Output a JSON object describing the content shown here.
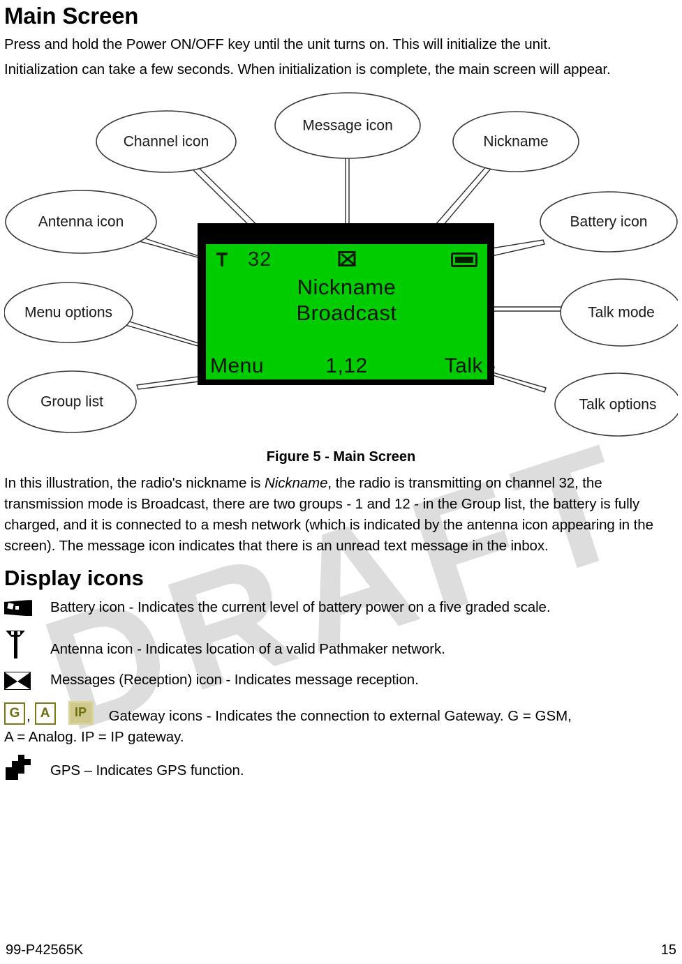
{
  "section1": {
    "heading": "Main Screen",
    "para1": "Press and hold the Power ON/OFF key until the unit turns on. This will initialize the unit.",
    "para2": "Initialization can take a few seconds. When initialization is complete, the main screen will appear."
  },
  "watermark": {
    "text": "DRAFT"
  },
  "figure": {
    "caption": "Figure 5 - Main Screen",
    "callouts": [
      {
        "id": "channel-icon",
        "label": "Channel icon"
      },
      {
        "id": "message-icon",
        "label": "Message icon"
      },
      {
        "id": "nickname",
        "label": "Nickname"
      },
      {
        "id": "antenna-icon",
        "label": "Antenna icon"
      },
      {
        "id": "battery-icon",
        "label": "Battery icon"
      },
      {
        "id": "menu-options",
        "label": "Menu options"
      },
      {
        "id": "talk-mode",
        "label": "Talk mode"
      },
      {
        "id": "group-list",
        "label": "Group list"
      },
      {
        "id": "talk-options",
        "label": "Talk options"
      }
    ],
    "lcd": {
      "channel": "32",
      "nickname": "Nickname",
      "mode": "Broadcast",
      "soft_left": "Menu",
      "group_list": "1,12",
      "soft_right": "Talk",
      "screen_color": "#00cc00",
      "bezel_color": "#000000"
    }
  },
  "description": {
    "text_before_italic": "In this illustration, the radio's nickname is ",
    "italic_word": "Nickname",
    "text_after_italic": ", the radio is transmitting on channel 32, the transmission mode is Broadcast, there are two groups - 1 and 12 - in the Group list, the battery is fully charged, and it is connected to a mesh network (which is indicated by the antenna icon appearing in the screen). The message icon indicates that there is an unread text message in the inbox."
  },
  "section2": {
    "heading": "Display icons",
    "items": [
      {
        "icon": "battery-icon",
        "desc": "Battery icon - Indicates the current level of battery power on a five graded scale."
      },
      {
        "icon": "antenna-icon",
        "desc": "Antenna icon - Indicates location of a valid Pathmaker network."
      },
      {
        "icon": "envelope-icon",
        "desc": "Messages (Reception) icon - Indicates message reception."
      }
    ],
    "gateway": {
      "icon_g": "G",
      "icon_a": "A",
      "icon_ip": "IP",
      "separator": ",",
      "desc_line1": "Gateway icons - Indicates the connection to external Gateway. G = GSM,",
      "desc_line2": "A = Analog. IP = IP gateway.",
      "icon_color": "#6e6e12"
    },
    "gps": {
      "icon": "gps-icon",
      "desc": "GPS – Indicates GPS function."
    }
  },
  "footer": {
    "doc_number": "99-P42565K",
    "page_number": "15"
  }
}
